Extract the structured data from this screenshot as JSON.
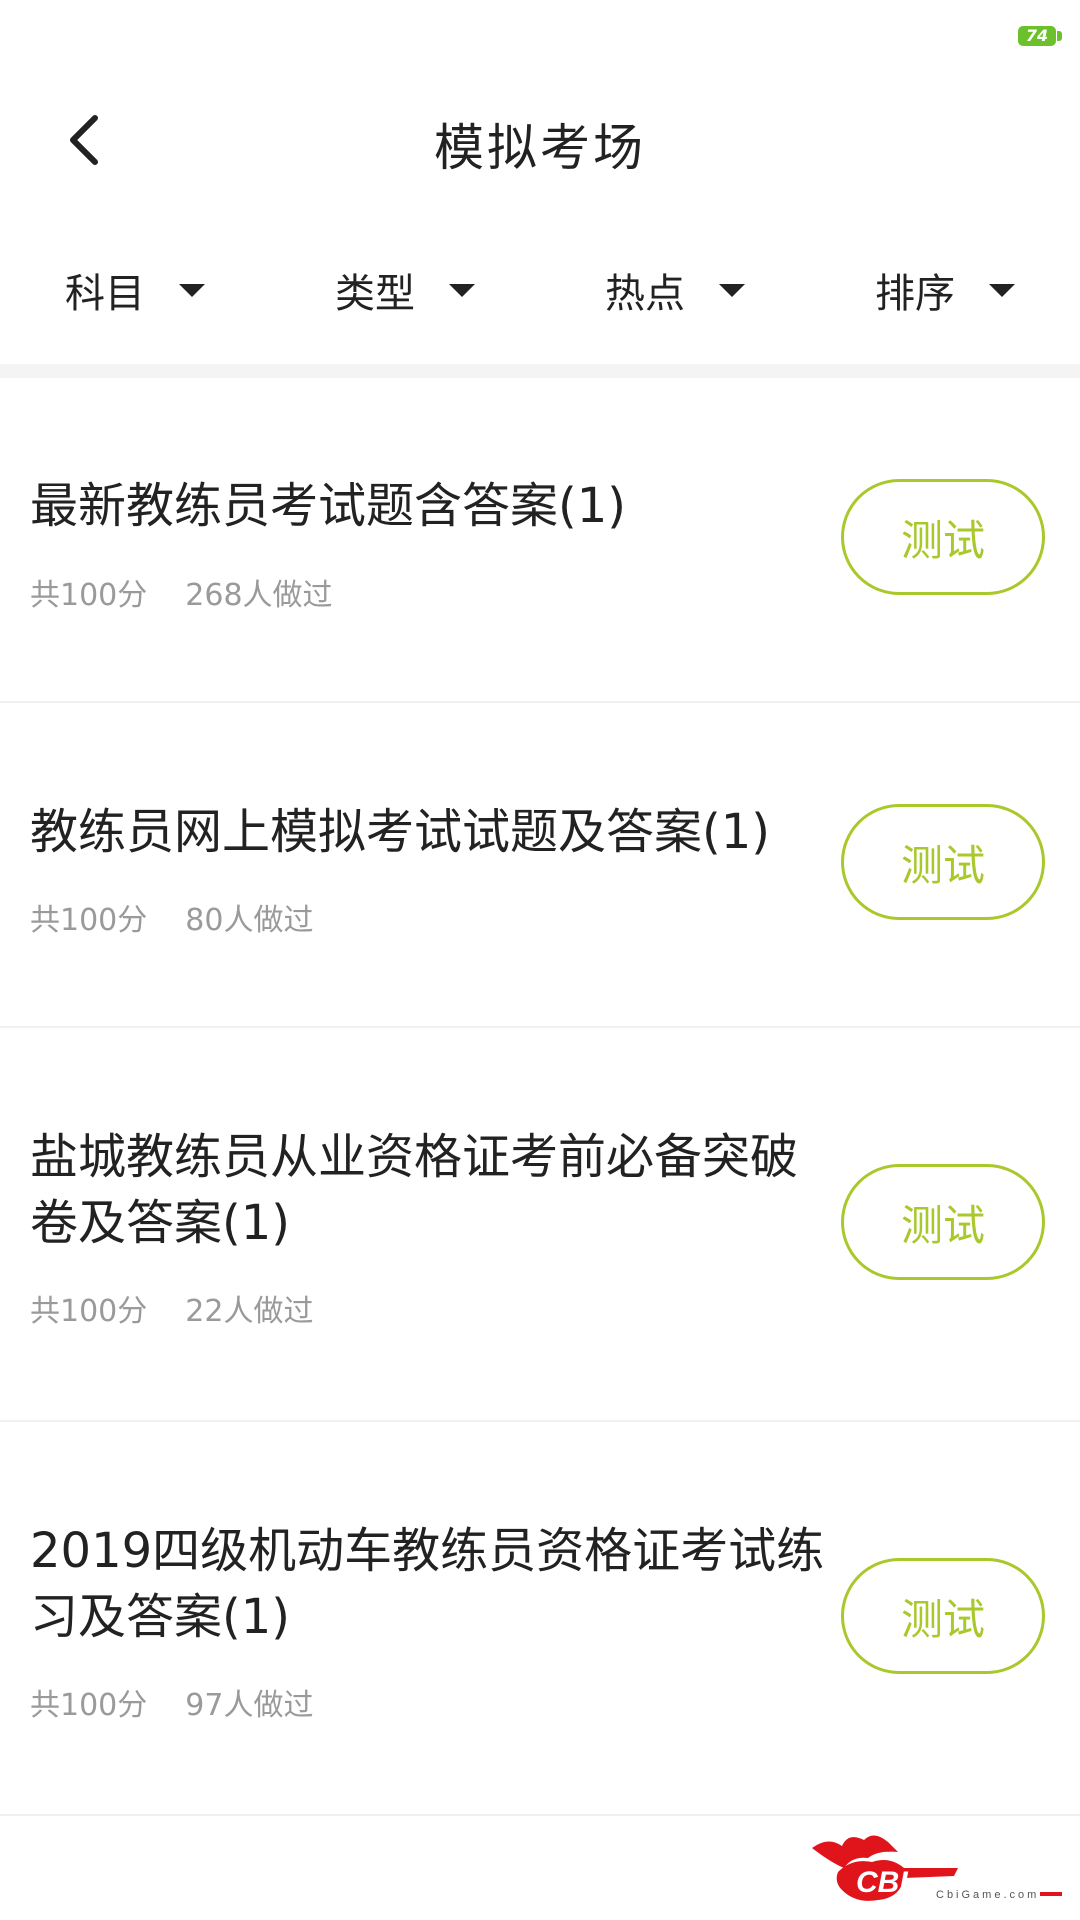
{
  "status_bar": {
    "battery_level": "74"
  },
  "nav": {
    "title": "模拟考场",
    "back_icon": "chevron-left-icon"
  },
  "filters": [
    {
      "label": "科目"
    },
    {
      "label": "类型"
    },
    {
      "label": "热点"
    },
    {
      "label": "排序"
    }
  ],
  "items": [
    {
      "title": "最新教练员考试题含答案(1)",
      "score": "共100分",
      "count": "268人做过",
      "button": "测试"
    },
    {
      "title": "教练员网上模拟考试试题及答案(1)",
      "score": "共100分",
      "count": "80人做过",
      "button": "测试"
    },
    {
      "title": "盐城教练员从业资格证考前必备突破卷及答案(1)",
      "score": "共100分",
      "count": "22人做过",
      "button": "测试"
    },
    {
      "title": "2019四级机动车教练员资格证考试练习及答案(1)",
      "score": "共100分",
      "count": "97人做过",
      "button": "测试"
    }
  ],
  "watermark": {
    "brand": "CBI",
    "site": "CbiGame.com"
  },
  "colors": {
    "accent": "#a9c82b",
    "battery": "#6cc02b",
    "meta_text": "#9a9a9a"
  }
}
